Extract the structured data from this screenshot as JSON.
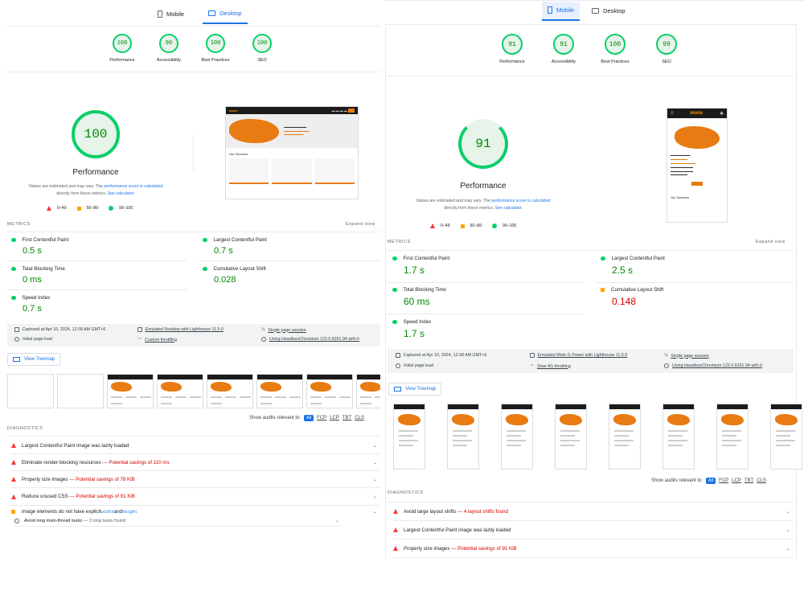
{
  "left": {
    "tabs": {
      "mobile": "Mobile",
      "desktop": "Desktop"
    },
    "scores": [
      {
        "value": "100",
        "label": "Performance"
      },
      {
        "value": "90",
        "label": "Accessibility"
      },
      {
        "value": "100",
        "label": "Best Practices"
      },
      {
        "value": "100",
        "label": "SEO"
      }
    ],
    "big_score": "100",
    "perf_title": "Performance",
    "note_a": "Values are estimated and may vary. The ",
    "note_link1": "performance score is calculated",
    "note_b": "directly from these metrics. ",
    "note_link2": "See calculator.",
    "legend": [
      "0–49",
      "50–89",
      "90–100"
    ],
    "metrics_label": "METRICS",
    "expand": "Expand view",
    "metrics": [
      {
        "name": "First Contentful Paint",
        "value": "0.5 s",
        "status": "good"
      },
      {
        "name": "Largest Contentful Paint",
        "value": "0.7 s",
        "status": "good"
      },
      {
        "name": "Total Blocking Time",
        "value": "0 ms",
        "status": "good"
      },
      {
        "name": "Cumulative Layout Shift",
        "value": "0.028",
        "status": "good"
      },
      {
        "name": "Speed Index",
        "value": "0.7 s",
        "status": "good"
      }
    ],
    "runinfo": {
      "captured": "Captured at Apr 10, 2024, 12:38 AM GMT+6",
      "emulated": "Emulated Desktop with Lighthouse 11.5.0",
      "session": "Single page session",
      "initial": "Initial page load",
      "throttle": "Custom throttling",
      "browser": "Using HeadlessChromium 122.0.6261.94 with lr"
    },
    "treemap": "View Treemap",
    "relevant_label": "Show audits relevant to:",
    "relevant": [
      "All",
      "FCP",
      "LCP",
      "TBT",
      "CLS"
    ],
    "diagnostics_label": "DIAGNOSTICS",
    "audits": [
      {
        "title": "Largest Contentful Paint image was lazily loaded",
        "savings": ""
      },
      {
        "title": "Eliminate render-blocking resources",
        "savings": " — Potential savings of 110 ms"
      },
      {
        "title": "Properly size images",
        "savings": " — Potential savings of 78 KiB"
      },
      {
        "title": "Reduce unused CSS",
        "savings": " — Potential savings of 91 KiB"
      }
    ],
    "audit5": {
      "pre": "Image elements do not have explicit ",
      "code1": "width",
      "mid": " and ",
      "code2": "height"
    },
    "audit6": {
      "title": "Avoid long main-thread tasks",
      "extra": " — 3 long tasks found"
    }
  },
  "right": {
    "tabs": {
      "mobile": "Mobile",
      "desktop": "Desktop"
    },
    "scores": [
      {
        "value": "91",
        "label": "Performance"
      },
      {
        "value": "91",
        "label": "Accessibility"
      },
      {
        "value": "100",
        "label": "Best Practices"
      },
      {
        "value": "99",
        "label": "SEO"
      }
    ],
    "big_score": "91",
    "perf_title": "Performance",
    "note_a": "Values are estimated and may vary. The ",
    "note_link1": "performance score is calculated",
    "note_b": "directly from these metrics. ",
    "note_link2": "See calculator.",
    "legend": [
      "0–49",
      "50–89",
      "90–100"
    ],
    "metrics_label": "METRICS",
    "expand": "Expand view",
    "metrics": [
      {
        "name": "First Contentful Paint",
        "value": "1.7 s",
        "status": "good"
      },
      {
        "name": "Largest Contentful Paint",
        "value": "2.5 s",
        "status": "good"
      },
      {
        "name": "Total Blocking Time",
        "value": "60 ms",
        "status": "good"
      },
      {
        "name": "Cumulative Layout Shift",
        "value": "0.148",
        "status": "average"
      },
      {
        "name": "Speed Index",
        "value": "1.7 s",
        "status": "good"
      }
    ],
    "runinfo": {
      "captured": "Captured at Apr 10, 2024, 12:38 AM GMT+6",
      "emulated": "Emulated Moto G Power with Lighthouse 11.5.0",
      "session": "Single page session",
      "initial": "Initial page load",
      "throttle": "Slow 4G throttling",
      "browser": "Using HeadlessChromium 122.0.6261.94 with lr"
    },
    "treemap": "View Treemap",
    "relevant_label": "Show audits relevant to:",
    "relevant": [
      "All",
      "FCP",
      "LCP",
      "TBT",
      "CLS"
    ],
    "diagnostics_label": "DIAGNOSTICS",
    "audits": [
      {
        "title": "Avoid large layout shifts",
        "savings": " — 4 layout shifts found"
      },
      {
        "title": "Largest Contentful Paint image was lazily loaded",
        "savings": ""
      },
      {
        "title": "Properly size images",
        "savings": " — Potential savings of 91 KiB"
      }
    ]
  },
  "shot": {
    "brand": "monx",
    "section": "Our Services"
  },
  "colors": {
    "pass": "#0cce6b",
    "average": "#ffa400",
    "fail": "#ff3333",
    "link": "#1a73e8"
  }
}
